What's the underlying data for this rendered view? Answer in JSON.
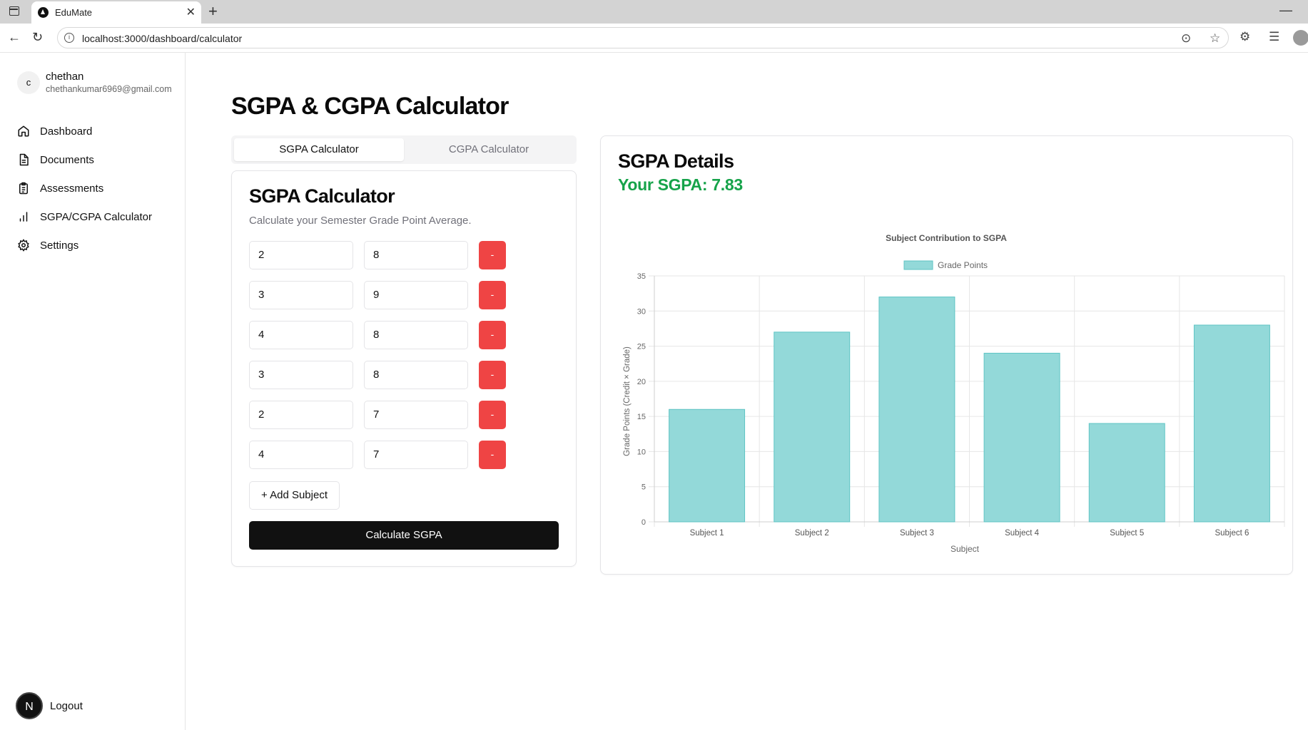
{
  "browser": {
    "tab_title": "EduMate",
    "url": "localhost:3000/dashboard/calculator"
  },
  "sidebar": {
    "avatar_initial": "c",
    "user_name": "chethan",
    "user_email": "chethankumar6969@gmail.com",
    "items": [
      {
        "label": "Dashboard",
        "icon": "home-icon"
      },
      {
        "label": "Documents",
        "icon": "document-icon"
      },
      {
        "label": "Assessments",
        "icon": "clipboard-icon"
      },
      {
        "label": "SGPA/CGPA Calculator",
        "icon": "bar-chart-icon"
      },
      {
        "label": "Settings",
        "icon": "gear-icon"
      }
    ],
    "logout_initial": "N",
    "logout_label": "Logout"
  },
  "main": {
    "title": "SGPA & CGPA Calculator",
    "tabs": [
      {
        "label": "SGPA Calculator",
        "active": true
      },
      {
        "label": "CGPA Calculator",
        "active": false
      }
    ],
    "calculator": {
      "title": "SGPA Calculator",
      "description": "Calculate your Semester Grade Point Average.",
      "subjects": [
        {
          "credits": "2",
          "grade": "8"
        },
        {
          "credits": "3",
          "grade": "9"
        },
        {
          "credits": "4",
          "grade": "8"
        },
        {
          "credits": "3",
          "grade": "8"
        },
        {
          "credits": "2",
          "grade": "7"
        },
        {
          "credits": "4",
          "grade": "7"
        }
      ],
      "remove_label": "-",
      "add_label": "+ Add Subject",
      "calculate_label": "Calculate SGPA"
    },
    "details": {
      "title": "SGPA Details",
      "result": "Your SGPA: 7.83"
    }
  },
  "colors": {
    "accent_green": "#16a34a",
    "danger": "#ef4444",
    "bar_fill": "#93d9d9",
    "bar_stroke": "#5fc4c4"
  },
  "chart_data": {
    "type": "bar",
    "title": "Subject Contribution to SGPA",
    "categories": [
      "Subject 1",
      "Subject 2",
      "Subject 3",
      "Subject 4",
      "Subject 5",
      "Subject 6"
    ],
    "series": [
      {
        "name": "Grade Points",
        "values": [
          16,
          27,
          32,
          24,
          14,
          28
        ]
      }
    ],
    "xlabel": "Subject",
    "ylabel": "Grade Points (Credit × Grade)",
    "ylim": [
      0,
      35
    ],
    "yticks": [
      0,
      5,
      10,
      15,
      20,
      25,
      30,
      35
    ],
    "grid": true,
    "legend": "top"
  }
}
